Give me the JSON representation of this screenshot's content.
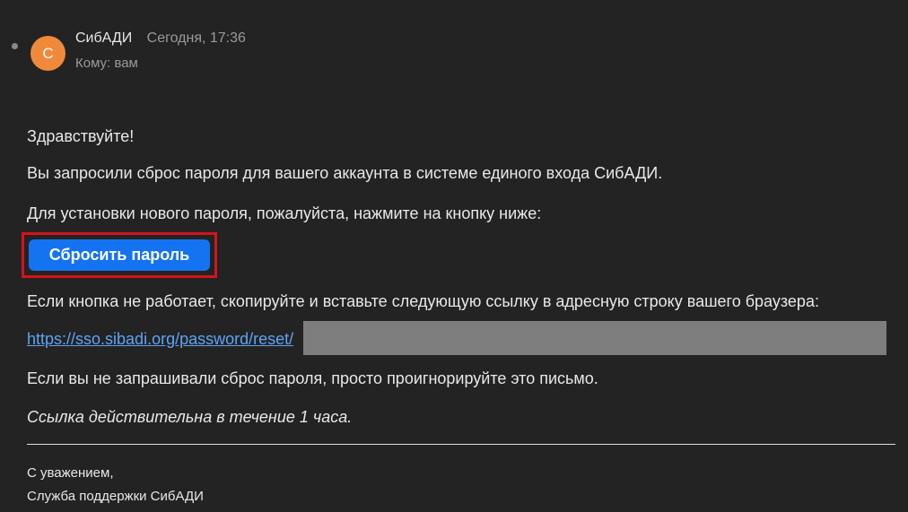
{
  "header": {
    "avatar_letter": "С",
    "sender_name": "СибАДИ",
    "time": "Сегодня, 17:36",
    "recipient": "Кому: вам"
  },
  "body": {
    "greeting": "Здравствуйте!",
    "request_text": "Вы запросили сброс пароля для вашего аккаунта в системе единого входа СибАДИ.",
    "instruction_text": "Для установки нового пароля, пожалуйста, нажмите на кнопку ниже:",
    "reset_button_label": "Сбросить пароль",
    "fallback_text": "Если кнопка не работает, скопируйте и вставьте следующую ссылку в адресную строку вашего браузера:",
    "reset_link": "https://sso.sibadi.org/password/reset/",
    "ignore_text": "Если вы не запрашивали сброс пароля, просто проигнорируйте это письмо.",
    "validity_text": "Ссылка действительна в течение 1 часа."
  },
  "signature": {
    "line1": "С уважением,",
    "line2": "Служба поддержки СибАДИ"
  },
  "colors": {
    "background": "#232323",
    "avatar": "#f08a3a",
    "button": "#1473f0",
    "highlight_border": "#d6131b",
    "link": "#5ea3f5",
    "redaction": "#7e7e7e"
  }
}
